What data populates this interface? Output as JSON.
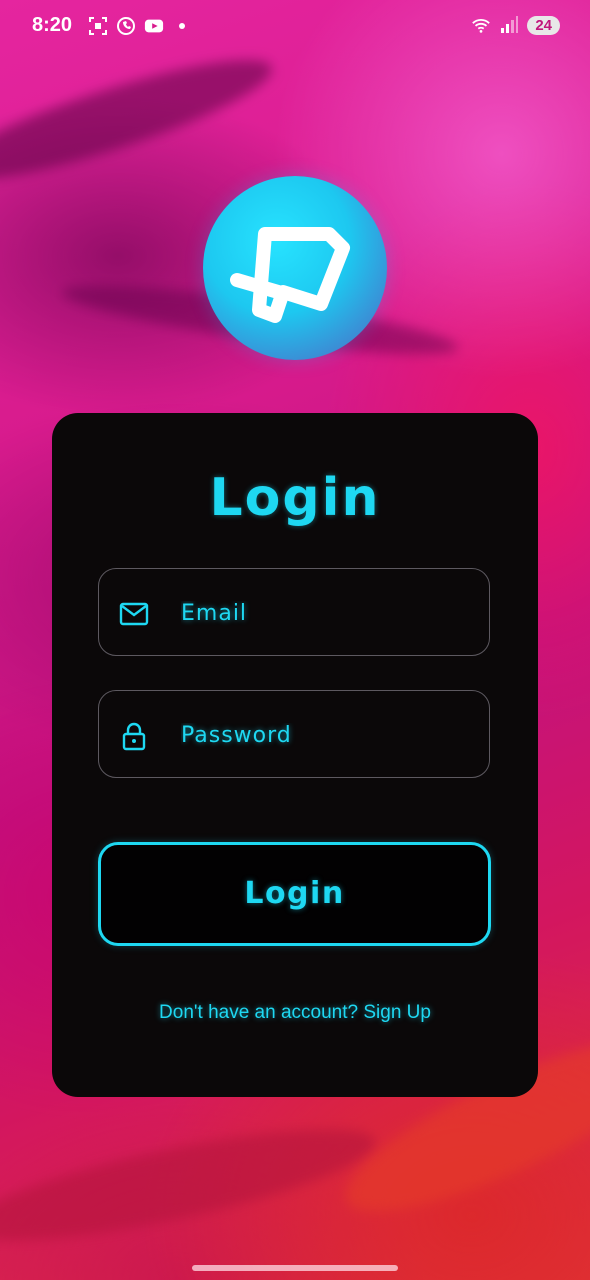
{
  "status_bar": {
    "time": "8:20",
    "left_icons": [
      "screenshot-icon",
      "whatsapp-icon",
      "youtube-icon",
      "notification-dot-icon"
    ],
    "right_icons": [
      "wifi-icon",
      "signal-icon"
    ],
    "battery": "24"
  },
  "app": {
    "logo": "app-logo-icon",
    "title": "Login",
    "email_field": {
      "placeholder": "Email",
      "value": "",
      "icon": "mail-icon"
    },
    "password_field": {
      "placeholder": "Password",
      "value": "",
      "icon": "lock-icon"
    },
    "login_button": "Login",
    "signup_text": "Don't have an account? Sign Up"
  },
  "colors": {
    "accent": "#1ED8F2",
    "card_bg": "#0B0809",
    "background": "#D81B8D"
  }
}
